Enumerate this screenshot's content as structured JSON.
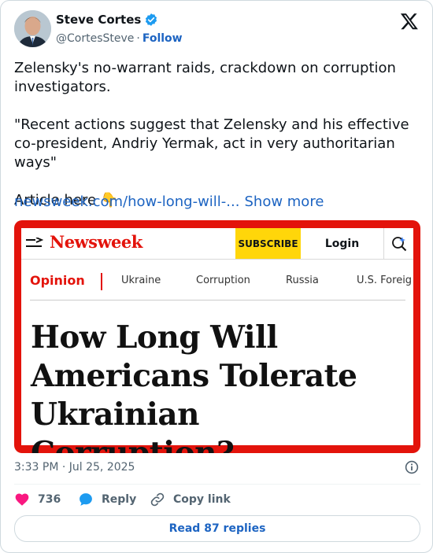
{
  "author": {
    "name": "Steve Cortes",
    "handle": "@CortesSteve",
    "separator": "·",
    "follow_label": "Follow"
  },
  "tweet": {
    "text": "Zelensky's no-warrant raids, crackdown on corruption investigators.\n\n\"Recent actions suggest that Zelensky and his effective co-president, Andriy Yermak, act in very authoritarian ways\"\n\nArticle here 👇",
    "link_text": "newsweek.com/how-long-will-...",
    "show_more_label": "Show more"
  },
  "media": {
    "logo_text": "Newsweek",
    "subscribe_label": "SUBSCRIBE",
    "login_label": "Login",
    "nav_section": "Opinion",
    "nav_items": [
      "Ukraine",
      "Corruption",
      "Russia",
      "U.S. Foreig"
    ],
    "headline": "How Long Will Americans Tolerate Ukrainian Corruption?",
    "border_color": "#e3130b",
    "subscribe_color": "#ffd60a"
  },
  "meta": {
    "timestamp": "3:33 PM · Jul 25, 2025"
  },
  "actions": {
    "like_count": "736",
    "reply_label": "Reply",
    "copy_link_label": "Copy link"
  },
  "footer": {
    "read_replies_label": "Read 87 replies"
  },
  "colors": {
    "link": "#1d64c2",
    "like": "#f91880",
    "verified": "#1d9bf0"
  }
}
